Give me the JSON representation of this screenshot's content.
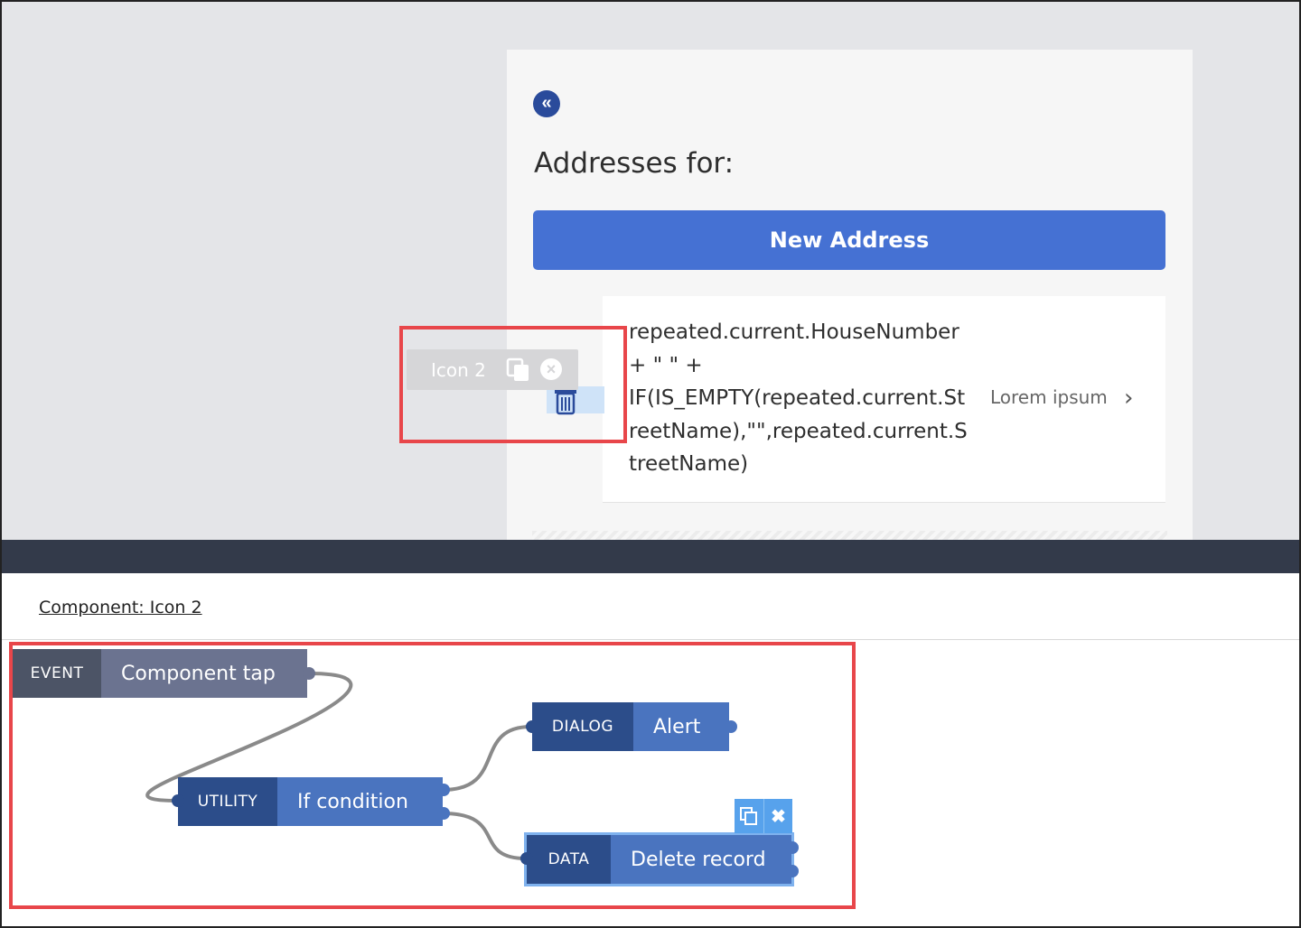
{
  "preview": {
    "back_icon": "double-chevron-left-icon",
    "page_title": "Addresses for:",
    "new_address_label": "New Address",
    "list_item": {
      "text": "repeated.current.HouseNumber\n+ \" \" +\nIF(IS_EMPTY(repeated.current.StreetName),\"\",repeated.current.StreetName)",
      "secondary": "Lorem ipsum",
      "chevron_icon": "chevron-right-icon"
    },
    "selected_component": {
      "label": "Icon 2",
      "copy_icon": "copy-icon",
      "close_icon": "close-circle-icon",
      "component_icon": "trash-icon"
    }
  },
  "logic": {
    "title": "Component: Icon 2",
    "nodes": [
      {
        "kind": "EVENT",
        "name": "Component tap"
      },
      {
        "kind": "UTILITY",
        "name": "If condition"
      },
      {
        "kind": "DIALOG",
        "name": "Alert"
      },
      {
        "kind": "DATA",
        "name": "Delete record"
      }
    ],
    "node_tools": {
      "copy_icon": "copy-icon",
      "delete_icon": "close-icon"
    }
  },
  "colors": {
    "highlight": "#e8464a",
    "primary": "#4571d3",
    "divider": "#333a4a"
  }
}
